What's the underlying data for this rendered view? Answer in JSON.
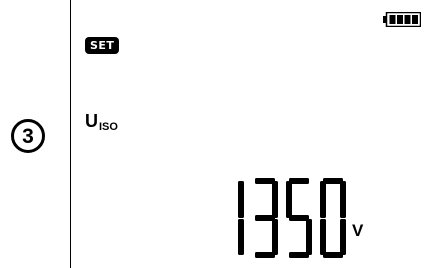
{
  "step": {
    "number": "3"
  },
  "status": {
    "set_label": "SET",
    "battery_icon": "battery-full-icon",
    "battery_level": 1.0
  },
  "parameter": {
    "symbol": "U",
    "subscript": "ISO"
  },
  "reading": {
    "value": "1350",
    "unit": "V"
  },
  "colors": {
    "segment": "#000000",
    "background": "#ffffff"
  }
}
